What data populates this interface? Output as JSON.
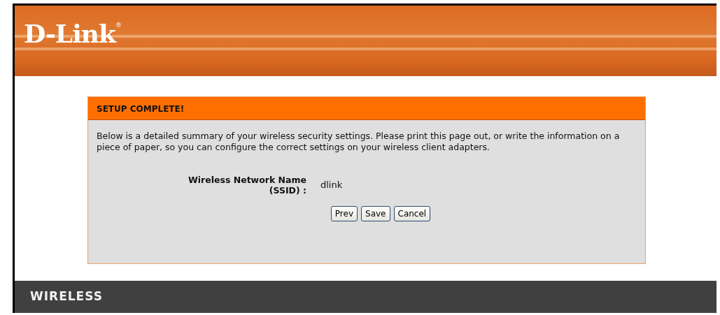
{
  "header": {
    "logo": "D-Link",
    "registered_mark": "®"
  },
  "panel": {
    "title": "SETUP COMPLETE!",
    "description": "Below is a detailed summary of your wireless security settings. Please print this page out, or write the information on a piece of paper, so you can configure the correct settings on your wireless client adapters.",
    "fields": [
      {
        "label_lines": [
          "Wireless Network Name",
          "(SSID) :"
        ],
        "value": "dlink"
      }
    ],
    "buttons": [
      "Prev",
      "Save",
      "Cancel"
    ]
  },
  "footer": {
    "label": "WIRELESS"
  }
}
